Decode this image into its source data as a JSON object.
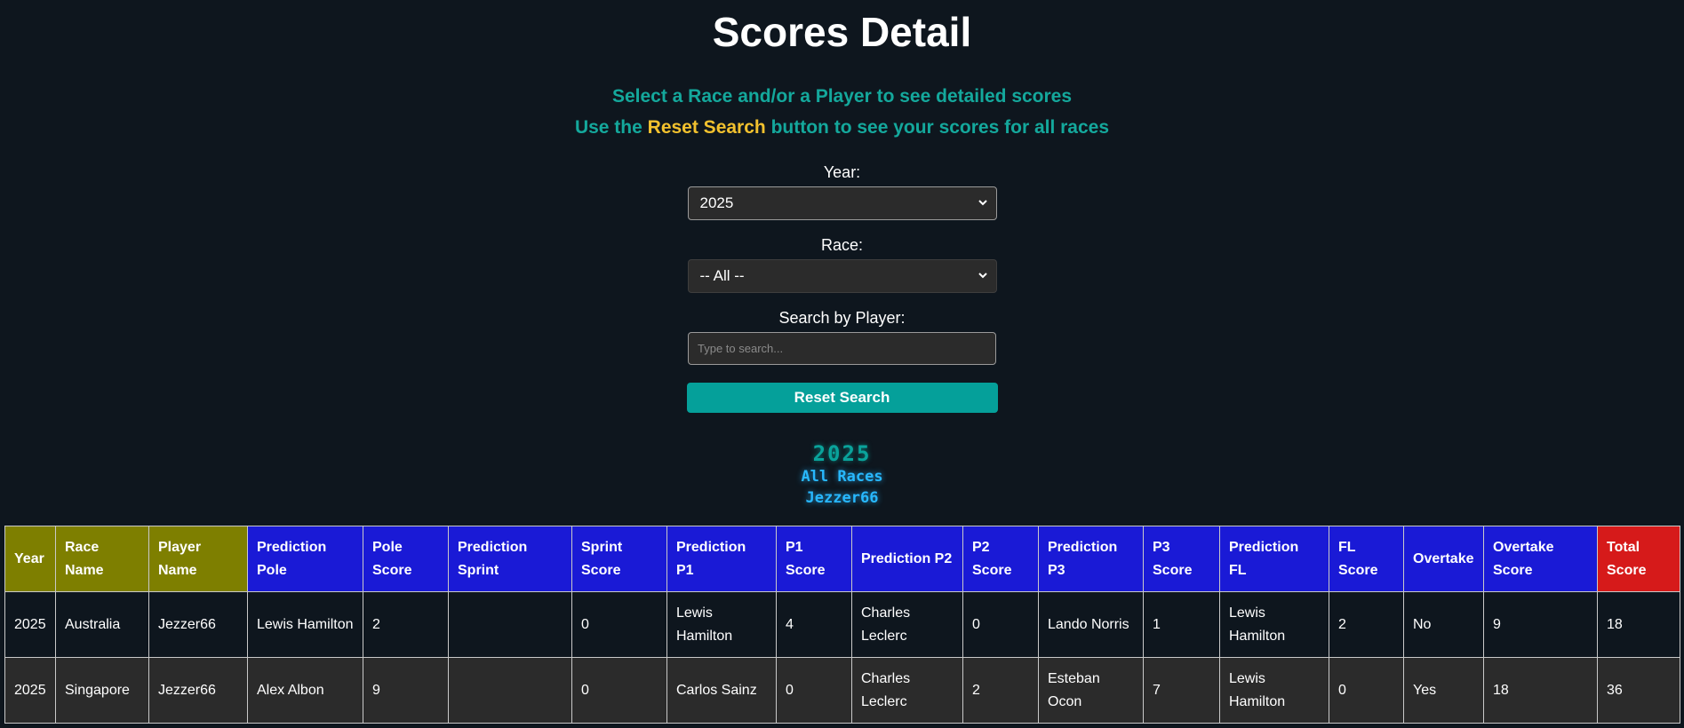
{
  "page": {
    "title": "Scores Detail",
    "instruction_line1": "Select a Race and/or a Player to see detailed scores",
    "instruction_line2_before": "Use the ",
    "instruction_line2_highlight": "Reset Search",
    "instruction_line2_after": " button to see your scores for all races"
  },
  "colors": {
    "background": "#0e161e",
    "teal_text": "#14a89c",
    "highlight": "#f2c12e",
    "reset_button": "#05a09a",
    "header_olive": "#7e7f00",
    "header_blue": "#1a1ad6",
    "header_red": "#d61a1a",
    "summary_cyan": "#28b8ff"
  },
  "filters": {
    "year_label": "Year:",
    "year_value": "2025",
    "race_label": "Race:",
    "race_value": "-- All --",
    "player_label": "Search by Player:",
    "player_placeholder": "Type to search...",
    "reset_label": "Reset Search"
  },
  "summary": {
    "year": "2025",
    "race": "All Races",
    "player": "Jezzer66"
  },
  "table": {
    "columns": [
      "Year",
      "Race Name",
      "Player Name",
      "Prediction Pole",
      "Pole Score",
      "Prediction Sprint",
      "Sprint Score",
      "Prediction P1",
      "P1 Score",
      "Prediction P2",
      "P2 Score",
      "Prediction P3",
      "P3 Score",
      "Prediction FL",
      "FL Score",
      "Overtake",
      "Overtake Score",
      "Total Score"
    ],
    "rows": [
      [
        "2025",
        "Australia",
        "Jezzer66",
        "Lewis Hamilton",
        "2",
        "",
        "0",
        "Lewis Hamilton",
        "4",
        "Charles Leclerc",
        "0",
        "Lando Norris",
        "1",
        "Lewis Hamilton",
        "2",
        "No",
        "9",
        "18"
      ],
      [
        "2025",
        "Singapore",
        "Jezzer66",
        "Alex Albon",
        "9",
        "",
        "0",
        "Carlos Sainz",
        "0",
        "Charles Leclerc",
        "2",
        "Esteban Ocon",
        "7",
        "Lewis Hamilton",
        "0",
        "Yes",
        "18",
        "36"
      ]
    ]
  }
}
